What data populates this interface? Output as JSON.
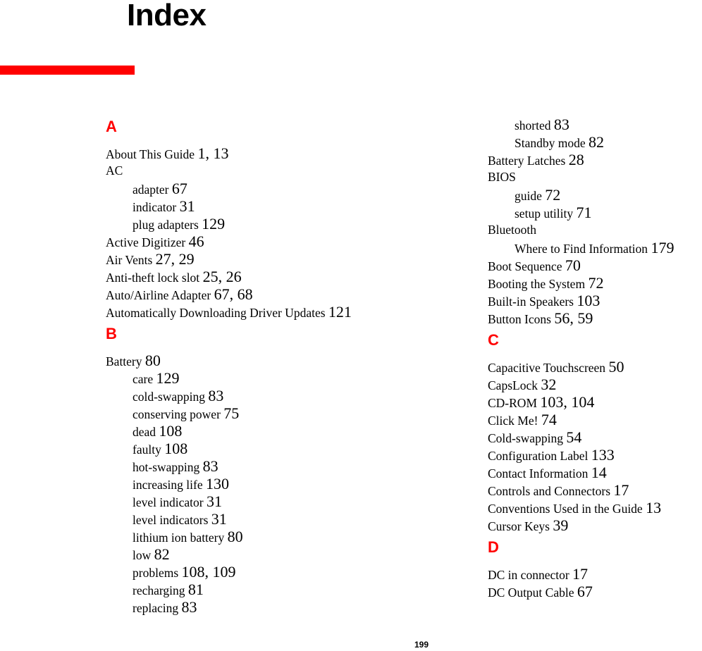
{
  "title": "Index",
  "accent_color": "#ff0000",
  "page_number": "199",
  "left_column": [
    {
      "type": "letter",
      "text": "A"
    },
    {
      "type": "entry",
      "level": 0,
      "term": "About This Guide",
      "pages": "1, 13"
    },
    {
      "type": "entry",
      "level": 0,
      "term": "AC",
      "pages": ""
    },
    {
      "type": "entry",
      "level": 1,
      "term": "adapter",
      "pages": "67"
    },
    {
      "type": "entry",
      "level": 1,
      "term": "indicator",
      "pages": "31"
    },
    {
      "type": "entry",
      "level": 1,
      "term": "plug adapters",
      "pages": "129"
    },
    {
      "type": "entry",
      "level": 0,
      "term": "Active Digitizer",
      "pages": "46"
    },
    {
      "type": "entry",
      "level": 0,
      "term": "Air Vents",
      "pages": "27, 29"
    },
    {
      "type": "entry",
      "level": 0,
      "term": "Anti-theft lock slot",
      "pages": "25, 26"
    },
    {
      "type": "entry",
      "level": 0,
      "term": "Auto/Airline Adapter",
      "pages": "67, 68"
    },
    {
      "type": "entry",
      "level": 0,
      "term": "Automatically Downloading Driver Updates",
      "pages": "121"
    },
    {
      "type": "letter",
      "text": "B"
    },
    {
      "type": "entry",
      "level": 0,
      "term": "Battery",
      "pages": "80"
    },
    {
      "type": "entry",
      "level": 1,
      "term": "care",
      "pages": "129"
    },
    {
      "type": "entry",
      "level": 1,
      "term": "cold-swapping",
      "pages": "83"
    },
    {
      "type": "entry",
      "level": 1,
      "term": "conserving power",
      "pages": "75"
    },
    {
      "type": "entry",
      "level": 1,
      "term": "dead",
      "pages": "108"
    },
    {
      "type": "entry",
      "level": 1,
      "term": "faulty",
      "pages": "108"
    },
    {
      "type": "entry",
      "level": 1,
      "term": "hot-swapping",
      "pages": "83"
    },
    {
      "type": "entry",
      "level": 1,
      "term": "increasing life",
      "pages": "130"
    },
    {
      "type": "entry",
      "level": 1,
      "term": "level indicator",
      "pages": "31"
    },
    {
      "type": "entry",
      "level": 1,
      "term": "level indicators",
      "pages": "31"
    },
    {
      "type": "entry",
      "level": 1,
      "term": "lithium ion battery",
      "pages": "80"
    },
    {
      "type": "entry",
      "level": 1,
      "term": "low",
      "pages": "82"
    },
    {
      "type": "entry",
      "level": 1,
      "term": "problems",
      "pages": "108, 109"
    },
    {
      "type": "entry",
      "level": 1,
      "term": "recharging",
      "pages": "81"
    },
    {
      "type": "entry",
      "level": 1,
      "term": "replacing",
      "pages": "83"
    }
  ],
  "right_column": [
    {
      "type": "entry",
      "level": 1,
      "term": "shorted",
      "pages": "83"
    },
    {
      "type": "entry",
      "level": 1,
      "term": "Standby mode",
      "pages": "82"
    },
    {
      "type": "entry",
      "level": 0,
      "term": "Battery Latches",
      "pages": "28"
    },
    {
      "type": "entry",
      "level": 0,
      "term": "BIOS",
      "pages": ""
    },
    {
      "type": "entry",
      "level": 1,
      "term": "guide",
      "pages": "72"
    },
    {
      "type": "entry",
      "level": 1,
      "term": "setup utility",
      "pages": "71"
    },
    {
      "type": "entry",
      "level": 0,
      "term": "Bluetooth",
      "pages": ""
    },
    {
      "type": "entry",
      "level": 1,
      "term": "Where to Find Information",
      "pages": "179"
    },
    {
      "type": "entry",
      "level": 0,
      "term": "Boot Sequence",
      "pages": "70"
    },
    {
      "type": "entry",
      "level": 0,
      "term": "Booting the System",
      "pages": "72"
    },
    {
      "type": "entry",
      "level": 0,
      "term": "Built-in Speakers",
      "pages": "103"
    },
    {
      "type": "entry",
      "level": 0,
      "term": "Button Icons",
      "pages": "56, 59"
    },
    {
      "type": "letter",
      "text": "C"
    },
    {
      "type": "entry",
      "level": 0,
      "term": "Capacitive Touchscreen",
      "pages": "50"
    },
    {
      "type": "entry",
      "level": 0,
      "term": "CapsLock",
      "pages": "32"
    },
    {
      "type": "entry",
      "level": 0,
      "term": "CD-ROM",
      "pages": "103, 104"
    },
    {
      "type": "entry",
      "level": 0,
      "term": "Click Me!",
      "pages": "74"
    },
    {
      "type": "entry",
      "level": 0,
      "term": "Cold-swapping",
      "pages": "54"
    },
    {
      "type": "entry",
      "level": 0,
      "term": "Configuration Label",
      "pages": "133"
    },
    {
      "type": "entry",
      "level": 0,
      "term": "Contact Information",
      "pages": "14"
    },
    {
      "type": "entry",
      "level": 0,
      "term": "Controls and Connectors",
      "pages": "17"
    },
    {
      "type": "entry",
      "level": 0,
      "term": "Conventions Used in the Guide",
      "pages": "13"
    },
    {
      "type": "entry",
      "level": 0,
      "term": "Cursor Keys",
      "pages": "39"
    },
    {
      "type": "letter",
      "text": "D"
    },
    {
      "type": "entry",
      "level": 0,
      "term": "DC in connector",
      "pages": "17"
    },
    {
      "type": "entry",
      "level": 0,
      "term": "DC Output Cable",
      "pages": "67"
    }
  ]
}
